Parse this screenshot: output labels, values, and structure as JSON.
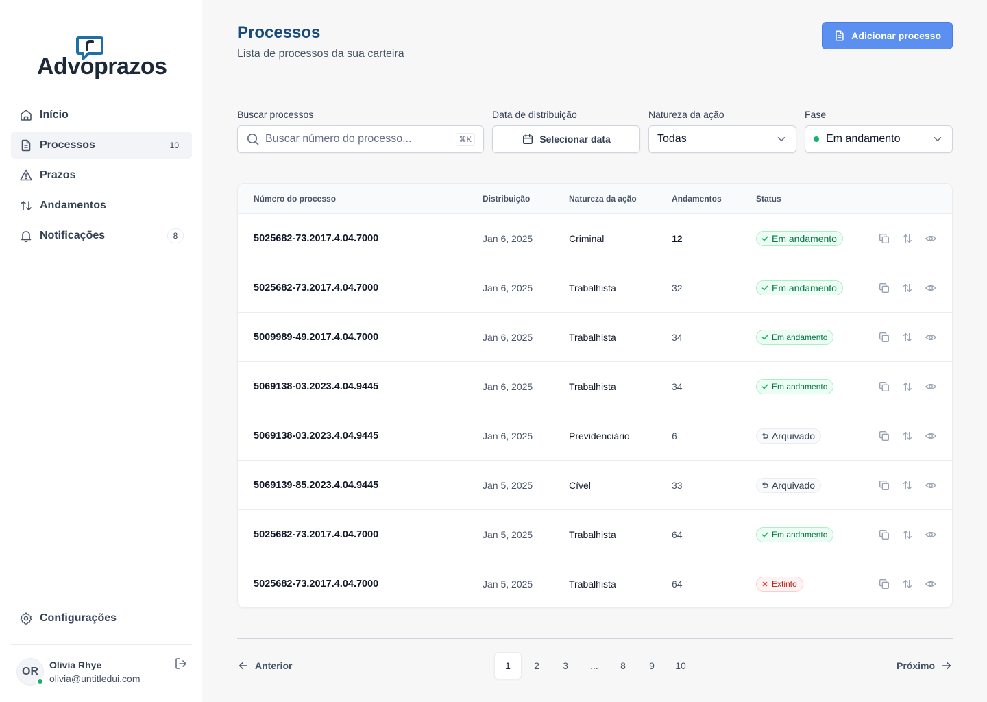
{
  "brand": {
    "name": "Advoprazos",
    "mark_color": "#1e6fa6"
  },
  "nav": {
    "items": [
      {
        "label": "Início",
        "icon": "home-icon"
      },
      {
        "label": "Processos",
        "icon": "file-icon",
        "badge": "10",
        "active": true
      },
      {
        "label": "Prazos",
        "icon": "warning-icon"
      },
      {
        "label": "Andamentos",
        "icon": "swap-vertical-icon"
      },
      {
        "label": "Notificações",
        "icon": "bell-icon",
        "badge": "8"
      }
    ],
    "settings_label": "Configurações"
  },
  "user": {
    "initials": "OR",
    "name": "Olivia Rhye",
    "email": "olivia@untitledui.com",
    "online": true
  },
  "header": {
    "title": "Processos",
    "subtitle": "Lista de processos da sua carteira",
    "add_button": "Adicionar processo"
  },
  "filters": {
    "search_label": "Buscar processos",
    "search_placeholder": "Buscar número do processo...",
    "search_shortcut": "⌘K",
    "date_label": "Data de distribuição",
    "date_button": "Selecionar data",
    "nature_label": "Natureza da ação",
    "nature_value": "Todas",
    "phase_label": "Fase",
    "phase_value": "Em andamento"
  },
  "table": {
    "columns": [
      "Número do processo",
      "Distribuição",
      "Natureza da ação",
      "Andamentos",
      "Status"
    ],
    "rows": [
      {
        "number": "5025682-73.2017.4.04.7000",
        "date": "Jan 6, 2025",
        "nature": "Criminal",
        "count": "12",
        "status": "Em andamento",
        "status_type": "green",
        "large": true,
        "count_bold": true
      },
      {
        "number": "5025682-73.2017.4.04.7000",
        "date": "Jan 6, 2025",
        "nature": "Trabalhista",
        "count": "32",
        "status": "Em andamento",
        "status_type": "green",
        "large": true
      },
      {
        "number": "5009989-49.2017.4.04.7000",
        "date": "Jan 6, 2025",
        "nature": "Trabalhista",
        "count": "34",
        "status": "Em andamento",
        "status_type": "green"
      },
      {
        "number": "5069138-03.2023.4.04.9445",
        "date": "Jan 6, 2025",
        "nature": "Trabalhista",
        "count": "34",
        "status": "Em andamento",
        "status_type": "green"
      },
      {
        "number": "5069138-03.2023.4.04.9445",
        "date": "Jan 6, 2025",
        "nature": "Previdenciário",
        "count": "6",
        "status": "Arquivado",
        "status_type": "gray",
        "large": true
      },
      {
        "number": "5069139-85.2023.4.04.9445",
        "date": "Jan 5, 2025",
        "nature": "Cível",
        "count": "33",
        "status": "Arquivado",
        "status_type": "gray",
        "large": true
      },
      {
        "number": "5025682-73.2017.4.04.7000",
        "date": "Jan 5, 2025",
        "nature": "Trabalhista",
        "count": "64",
        "status": "Em andamento",
        "status_type": "green"
      },
      {
        "number": "5025682-73.2017.4.04.7000",
        "date": "Jan 5, 2025",
        "nature": "Trabalhista",
        "count": "64",
        "status": "Extinto",
        "status_type": "red"
      }
    ],
    "row_actions": [
      "copy-icon",
      "sort-icon",
      "eye-icon"
    ]
  },
  "pagination": {
    "prev": "Anterior",
    "next": "Próximo",
    "pages": [
      "1",
      "2",
      "3",
      "...",
      "8",
      "9",
      "10"
    ],
    "current": "1"
  }
}
